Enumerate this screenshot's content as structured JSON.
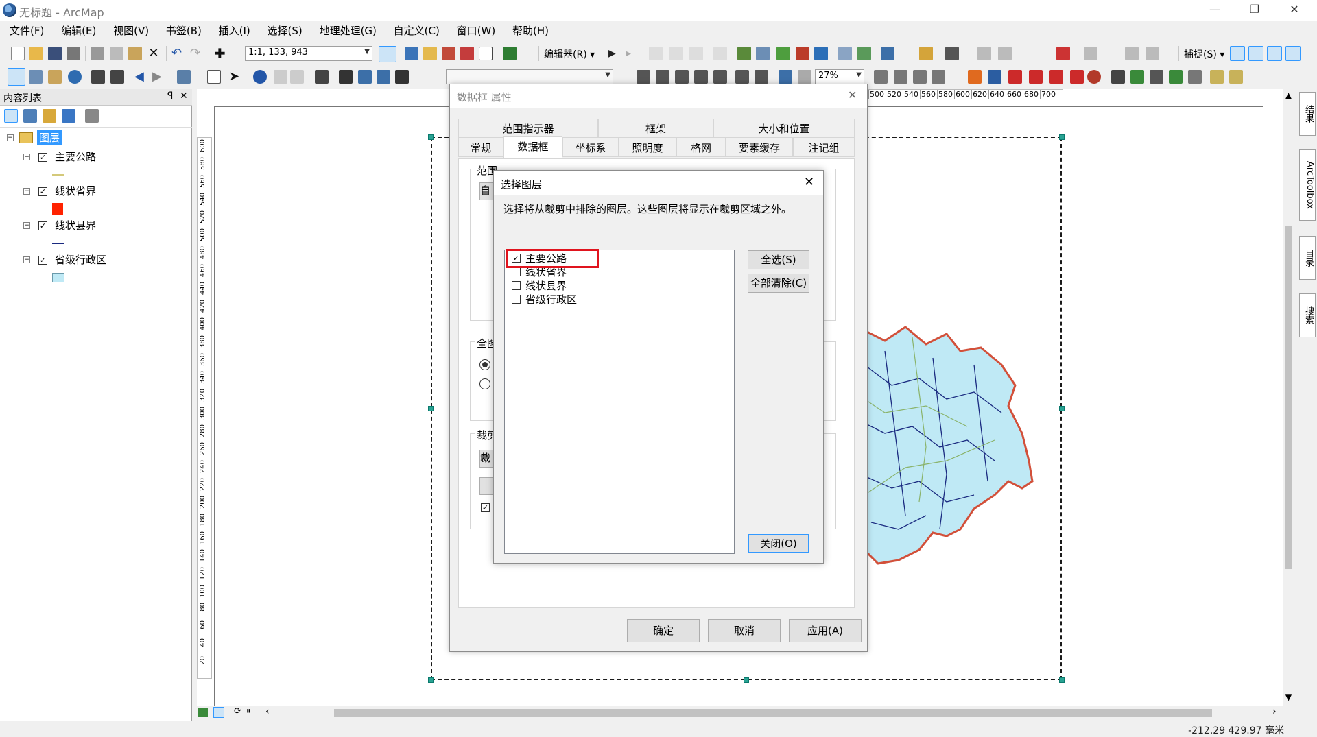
{
  "app": {
    "title": "无标题 - ArcMap",
    "minimize": "—",
    "restore": "❐",
    "close": "✕"
  },
  "menu": [
    "文件(F)",
    "编辑(E)",
    "视图(V)",
    "书签(B)",
    "插入(I)",
    "选择(S)",
    "地理处理(G)",
    "自定义(C)",
    "窗口(W)",
    "帮助(H)"
  ],
  "toolbar": {
    "scale_value": "1:1, 133, 943",
    "editor_label": "编辑器(R)",
    "snapping_label": "捕捉(S)",
    "zoom_value": "27%"
  },
  "toc": {
    "title": "内容列表",
    "pin": "ꟼ",
    "close": "✕",
    "root_label": "图层",
    "layers": [
      {
        "name": "主要公路",
        "checked": true,
        "symbol": "line",
        "color": "#d4c97a"
      },
      {
        "name": "线状省界",
        "checked": true,
        "symbol": "fill",
        "color": "#ff2200"
      },
      {
        "name": "线状县界",
        "checked": true,
        "symbol": "line",
        "color": "#1a2a80"
      },
      {
        "name": "省级行政区",
        "checked": true,
        "symbol": "fill",
        "color": "#bfe9f5"
      }
    ]
  },
  "ruler": {
    "top": [
      "500",
      "520",
      "540",
      "560",
      "580",
      "600",
      "620",
      "640",
      "660",
      "680",
      "700"
    ],
    "left": [
      "600",
      "580",
      "560",
      "540",
      "520",
      "500",
      "480",
      "460",
      "440",
      "420",
      "400",
      "380",
      "360",
      "340",
      "320",
      "300",
      "280",
      "260",
      "240",
      "220",
      "200",
      "180",
      "160",
      "140",
      "120",
      "100",
      "80",
      "60",
      "40",
      "20"
    ]
  },
  "right_dock": [
    "结果",
    "ArcToolbox",
    "目录",
    "搜索"
  ],
  "status": "-212.29  429.97 毫米",
  "props_dialog": {
    "title": "数据框 属性",
    "tabs_row1": [
      "范围指示器",
      "框架",
      "大小和位置"
    ],
    "tabs_row2": [
      "常规",
      "数据框",
      "坐标系",
      "照明度",
      "格网",
      "要素缓存",
      "注记组"
    ],
    "active_tab": "数据框",
    "group_labels": [
      "范围",
      "全图",
      "裁剪"
    ],
    "partial_text": [
      "自",
      "裁"
    ],
    "buttons": {
      "ok": "确定",
      "cancel": "取消",
      "apply": "应用(A)"
    }
  },
  "select_dialog": {
    "title": "选择图层",
    "instruction": "选择将从裁剪中排除的图层。这些图层将显示在裁剪区域之外。",
    "items": [
      {
        "name": "主要公路",
        "checked": true
      },
      {
        "name": "线状省界",
        "checked": false
      },
      {
        "name": "线状县界",
        "checked": false
      },
      {
        "name": "省级行政区",
        "checked": false
      }
    ],
    "buttons": {
      "select_all": "全选(S)",
      "clear_all": "全部清除(C)",
      "close": "关闭(O)"
    },
    "highlight_color": "#e0141e"
  }
}
